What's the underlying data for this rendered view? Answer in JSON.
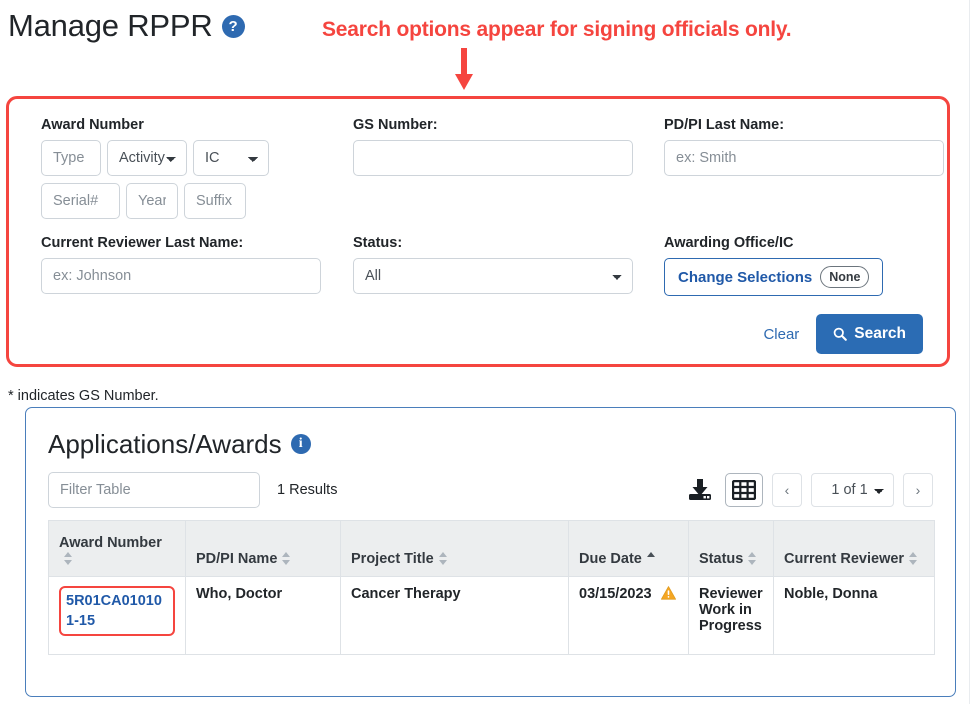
{
  "header": {
    "title": "Manage RPPR",
    "help_icon": "help-circle-icon",
    "help_glyph": "?"
  },
  "annotation": {
    "text": "Search options appear for signing officials only.",
    "color": "#f5453f",
    "arrow_icon": "arrow-down-icon"
  },
  "search_form": {
    "border_color": "#f5453f",
    "award_number": {
      "label": "Award Number",
      "type_placeholder": "Type",
      "type_value": "",
      "activity_value": "Activity",
      "activity_options": [
        "Activity"
      ],
      "ic_value": "IC",
      "ic_options": [
        "IC"
      ],
      "serial_placeholder": "Serial#",
      "serial_value": "",
      "year_placeholder": "Year",
      "year_value": "",
      "suffix_placeholder": "Suffix",
      "suffix_value": ""
    },
    "gs_number": {
      "label": "GS Number:",
      "placeholder": "",
      "value": ""
    },
    "pdpi_last_name": {
      "label": "PD/PI Last Name:",
      "placeholder": "ex: Smith",
      "value": ""
    },
    "current_reviewer_last_name": {
      "label": "Current Reviewer Last Name:",
      "placeholder": "ex: Johnson",
      "value": ""
    },
    "status": {
      "label": "Status:",
      "value": "All",
      "options": [
        "All"
      ]
    },
    "awarding_office": {
      "label": "Awarding Office/IC",
      "button_label": "Change Selections",
      "pill_label": "None"
    },
    "clear_label": "Clear",
    "search_label": "Search",
    "search_icon": "magnifier-icon",
    "search_button_color": "#2b6cb4"
  },
  "gs_note": "* indicates GS Number.",
  "results": {
    "title": "Applications/Awards",
    "info_icon": "info-circle-icon",
    "info_glyph": "i",
    "filter_placeholder": "Filter Table",
    "filter_value": "",
    "count_label": "1 Results",
    "download_icon": "download-icon",
    "grid_icon": "table-grid-icon",
    "prev_label": "‹",
    "next_label": "›",
    "page_value": "1 of 1",
    "page_options": [
      "1 of 1"
    ],
    "panel_border_color": "#4a7ebb",
    "columns": [
      {
        "label": "Award Number",
        "sort": "none"
      },
      {
        "label": "PD/PI Name",
        "sort": "none"
      },
      {
        "label": "Project Title",
        "sort": "none"
      },
      {
        "label": "Due Date",
        "sort": "asc"
      },
      {
        "label": "Status",
        "sort": "none"
      },
      {
        "label": "Current Reviewer",
        "sort": "none"
      }
    ],
    "rows": [
      {
        "award_number": "5R01CA010101-15",
        "award_number_highlighted": true,
        "pdpi_name": "Who, Doctor",
        "project_title": "Cancer Therapy",
        "due_date": "03/15/2023",
        "due_date_warning_icon": "warning-triangle-icon",
        "status": "Reviewer Work in Progress",
        "current_reviewer": "Noble, Donna"
      }
    ]
  }
}
